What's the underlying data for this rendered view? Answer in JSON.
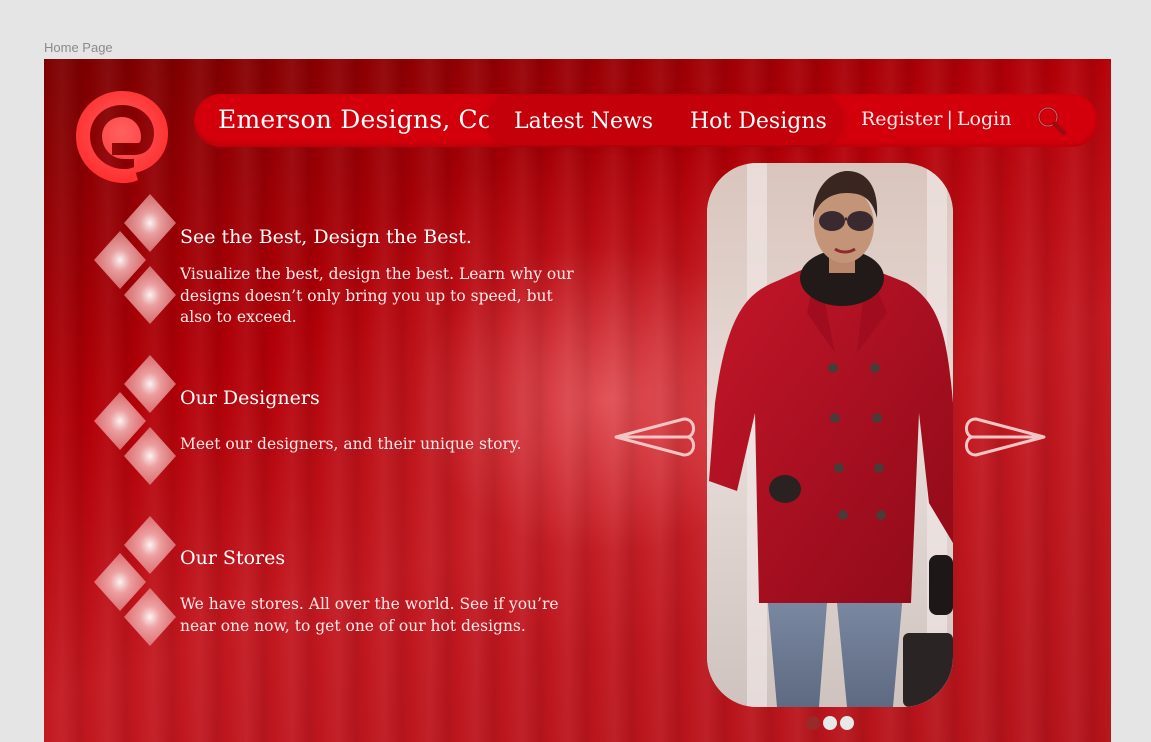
{
  "frame": {
    "label": "Home Page"
  },
  "header": {
    "brand": "Emerson Designs, Co.",
    "nav": [
      {
        "label": "Latest News"
      },
      {
        "label": "Hot Designs"
      }
    ],
    "register_label": "Register",
    "separator": "|",
    "login_label": "Login"
  },
  "features": [
    {
      "title": "See the Best, Design the Best.",
      "body": "Visualize the best, design the best. Learn why our designs doesn’t only bring you up to speed, but also to exceed."
    },
    {
      "title": "Our Designers",
      "body": "Meet our designers, and their unique story."
    },
    {
      "title": "Our Stores",
      "body": "We have stores. All over the world. See if you’re near one now, to get one of our hot designs."
    }
  ],
  "carousel": {
    "slide_count": 3,
    "active_index": 0
  },
  "colors": {
    "nav_bar": "#d3000b",
    "nav_pill": "#c4000a",
    "logo": "#ff3b3b",
    "coat": "#b3101f",
    "dot_active": "#9a2a2a",
    "dot_inactive": "#e8e8e8"
  },
  "icons": [
    "logo-icon",
    "search-icon",
    "diamond-icon",
    "arrow-left-icon",
    "arrow-right-icon"
  ]
}
